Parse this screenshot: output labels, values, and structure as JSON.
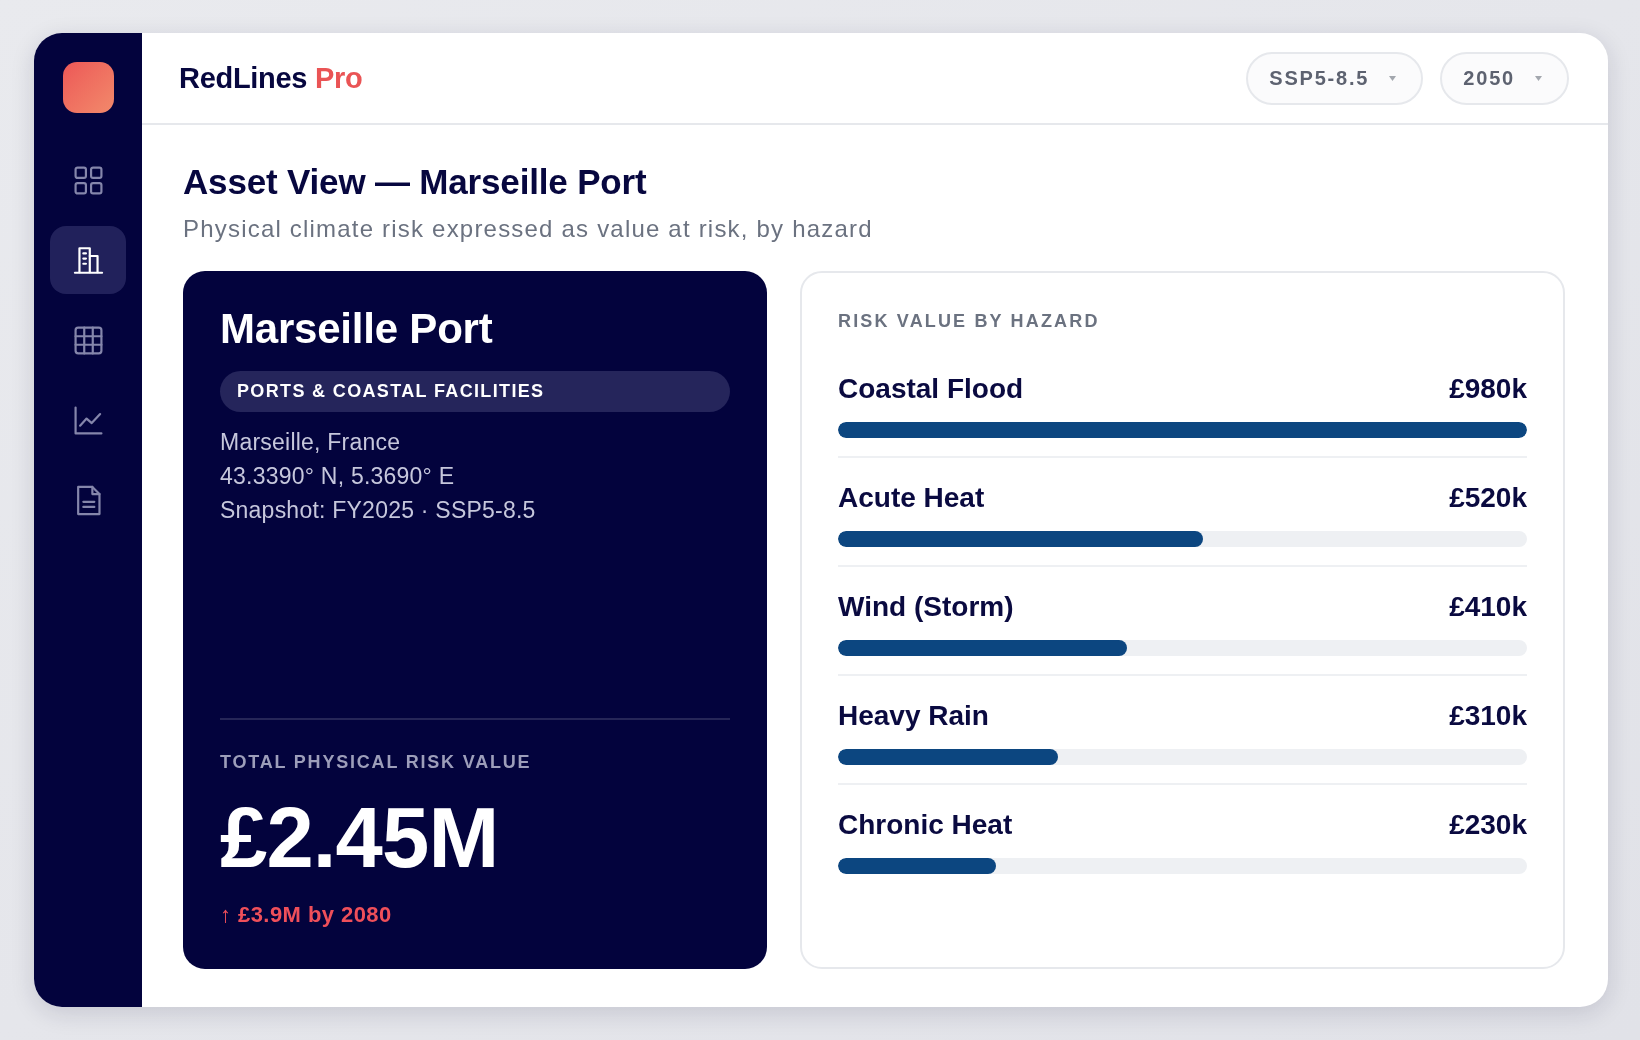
{
  "sidebar": {
    "items": [
      {
        "selected": false
      },
      {
        "selected": true
      },
      {
        "selected": false
      },
      {
        "selected": false
      },
      {
        "selected": false
      }
    ]
  },
  "header": {
    "brand": {
      "name": "RedLines",
      "edition": "Pro"
    },
    "dropdowns": [
      {
        "value": "SSP5-8.5"
      },
      {
        "value": "2050"
      }
    ]
  },
  "page": {
    "title": "Asset View — Marseille Port",
    "subtitle": "Physical climate risk expressed as value at risk, by hazard"
  },
  "asset_card": {
    "name": "Marseille Port",
    "category": "PORTS & COASTAL FACILITIES",
    "details": [
      "Marseille, France",
      "43.3390° N, 5.3690° E",
      "Snapshot: FY2025 · SSP5-8.5"
    ],
    "total_label": "TOTAL PHYSICAL RISK VALUE",
    "total_value": "£2.45M",
    "projection": "↑ £3.9M by 2080"
  },
  "hazard_panel": {
    "title": "RISK VALUE BY HAZARD",
    "hazards": [
      {
        "name": "Coastal Flood",
        "value": "£980k",
        "level": 1
      },
      {
        "name": "Acute Heat",
        "value": "£520k",
        "level": 0.53
      },
      {
        "name": "Wind (Storm)",
        "value": "£410k",
        "level": 0.42
      },
      {
        "name": "Heavy Rain",
        "value": "£310k",
        "level": 0.32
      },
      {
        "name": "Chronic Heat",
        "value": "£230k",
        "level": 0.23
      }
    ]
  }
}
